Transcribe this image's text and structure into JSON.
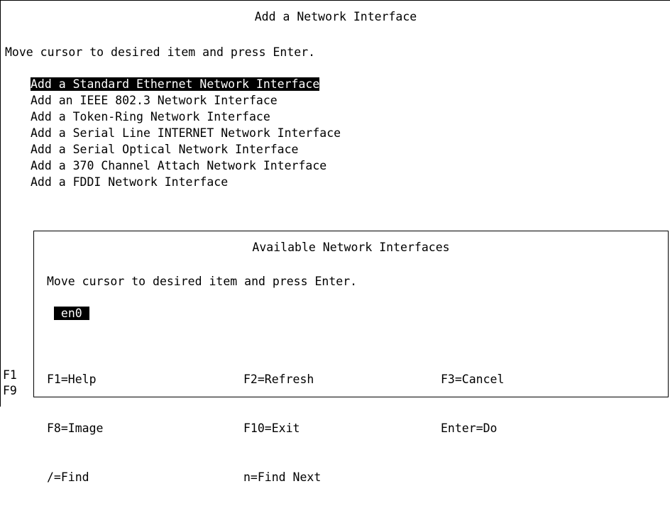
{
  "screen": {
    "title": "Add a Network Interface",
    "instruction": "Move cursor to desired item and press Enter.",
    "menu_items": [
      "Add a Standard Ethernet Network Interface",
      "Add an IEEE 802.3 Network Interface",
      "Add a Token-Ring Network Interface",
      "Add a Serial Line INTERNET Network Interface",
      "Add a Serial Optical Network Interface",
      "Add a 370 Channel Attach Network Interface",
      "Add a FDDI Network Interface"
    ],
    "selected_index": 0
  },
  "dialog": {
    "title": "Available Network Interfaces",
    "instruction": "Move cursor to desired item and press Enter.",
    "options": [
      " en0 "
    ],
    "function_keys": {
      "col1": [
        "F1=Help",
        "F8=Image",
        "/=Find"
      ],
      "col2": [
        "F2=Refresh",
        "F10=Exit",
        "n=Find Next"
      ],
      "col3": [
        "F3=Cancel",
        "Enter=Do"
      ]
    }
  },
  "obscured_keys": [
    "F1",
    "F9"
  ],
  "colors": {
    "background": "#ffffff",
    "foreground": "#000000",
    "highlight_bg": "#000000",
    "highlight_fg": "#ffffff"
  }
}
